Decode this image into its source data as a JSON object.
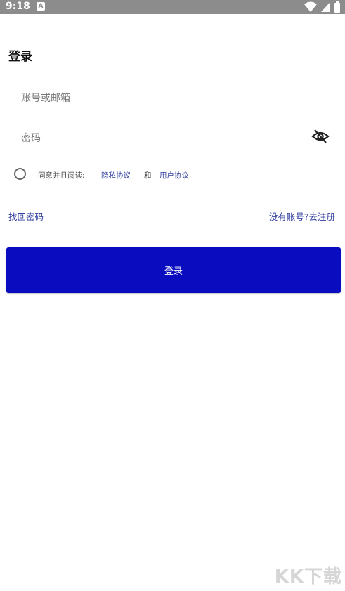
{
  "status_bar": {
    "time": "9:18",
    "notification_icon": "A"
  },
  "title": "登录",
  "account_field": {
    "placeholder": "账号或邮箱"
  },
  "password_field": {
    "placeholder": "密码"
  },
  "agreement": {
    "prefix": "同意并且阅读:",
    "privacy_link": "隐私协议",
    "and": "和",
    "user_link": "用户协议"
  },
  "links": {
    "forgot_password": "找回密码",
    "register": "没有账号?去注册"
  },
  "login_button": "登录",
  "watermark": "KK下载",
  "colors": {
    "primary_button": "#0a0cc0",
    "link": "#2f3d9e",
    "status_bar": "#8c8c8c"
  }
}
